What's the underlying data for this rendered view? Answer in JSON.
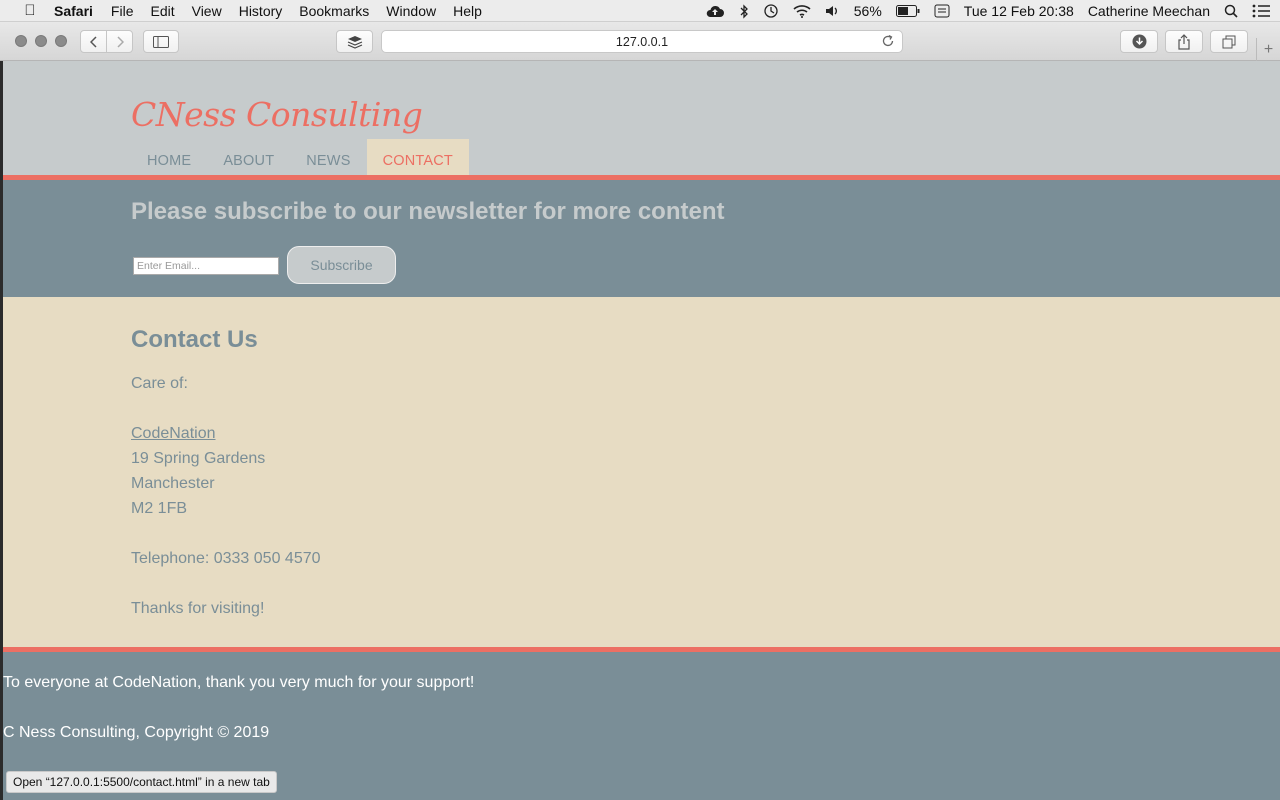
{
  "menubar": {
    "app": "Safari",
    "items": [
      "File",
      "Edit",
      "View",
      "History",
      "Bookmarks",
      "Window",
      "Help"
    ],
    "battery": "56%",
    "datetime": "Tue 12 Feb  20:38",
    "user": "Catherine Meechan"
  },
  "browser": {
    "url": "127.0.0.1",
    "status": "Open “127.0.0.1:5500/contact.html” in a new tab"
  },
  "site": {
    "logo": "CNess Consulting",
    "nav": [
      "HOME",
      "ABOUT",
      "NEWS",
      "CONTACT"
    ],
    "active_nav": "CONTACT",
    "subscribe": {
      "heading": "Please subscribe to our newsletter for more content",
      "placeholder": "Enter Email...",
      "button": "Subscribe"
    },
    "contact": {
      "heading": "Contact Us",
      "care_of": "Care of:",
      "org": "CodeNation",
      "address": [
        "19 Spring Gardens",
        "Manchester",
        "M2 1FB"
      ],
      "telephone": "Telephone: 0333 050 4570",
      "thanks": "Thanks for visiting!"
    },
    "footer": {
      "thanks": "To everyone at CodeNation, thank you very much for your support!",
      "copyright": "C Ness Consulting, Copyright © 2019"
    }
  },
  "colors": {
    "accent": "#ec6f63",
    "slate": "#7a8e97",
    "cream": "#e7dcc3",
    "header_gray": "#c6cbcc"
  }
}
